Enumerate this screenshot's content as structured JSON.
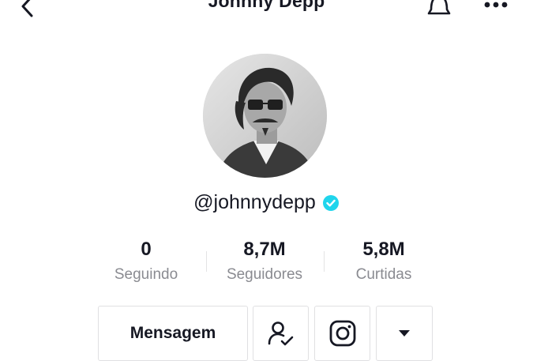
{
  "header": {
    "title": "Johnny Depp",
    "back_icon": "chevron-left-icon",
    "bell_icon": "bell-icon",
    "more_icon": "more-horizontal-icon"
  },
  "profile": {
    "handle": "@johnnydepp",
    "verified_icon": "verified-badge-icon",
    "verified_color": "#20D5EC"
  },
  "stats": [
    {
      "value": "0",
      "label": "Seguindo"
    },
    {
      "value": "8,7M",
      "label": "Seguidores"
    },
    {
      "value": "5,8M",
      "label": "Curtidas"
    }
  ],
  "actions": {
    "message_label": "Mensagem",
    "following_icon": "user-check-icon",
    "instagram_icon": "instagram-icon",
    "dropdown_icon": "caret-down-icon"
  }
}
